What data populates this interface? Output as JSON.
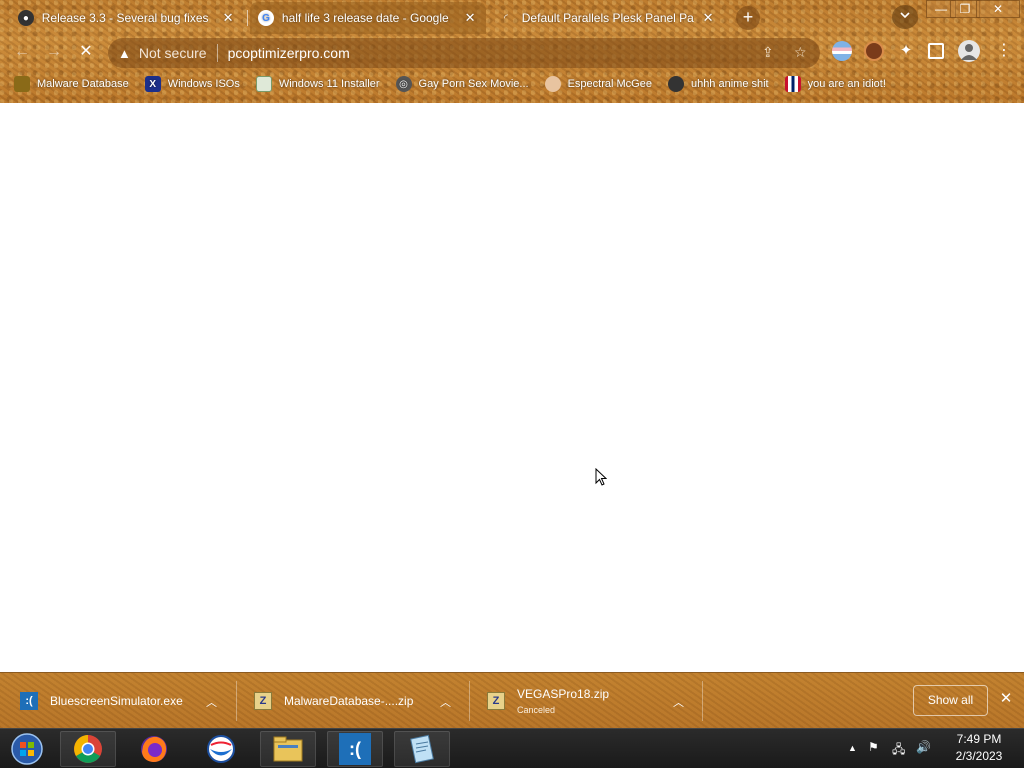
{
  "tabs": [
    {
      "title": "Release 3.3 - Several bug fixes",
      "favicon": "github-icon"
    },
    {
      "title": "half life 3 release date - Google",
      "favicon": "google-icon"
    },
    {
      "title": "Default Parallels Plesk Panel Page",
      "favicon": "loading-icon"
    }
  ],
  "window_controls": {
    "minimize": "—",
    "maximize": "❐",
    "close": "✕"
  },
  "omnibox": {
    "security_label": "Not secure",
    "url": "pcoptimizerpro.com"
  },
  "bookmarks": [
    {
      "label": "Malware Database",
      "icon": "malware-icon"
    },
    {
      "label": "Windows ISOs",
      "icon": "x-logo-icon"
    },
    {
      "label": "Windows 11 Installer",
      "icon": "image-icon"
    },
    {
      "label": "Gay Porn Sex Movie...",
      "icon": "disk-icon"
    },
    {
      "label": "Espectral McGee",
      "icon": "face-icon"
    },
    {
      "label": "uhhh anime shit",
      "icon": "anime-icon"
    },
    {
      "label": "you are an idiot!",
      "icon": "flag-icon"
    }
  ],
  "downloads": [
    {
      "name": "BluescreenSimulator.exe",
      "status": "",
      "icon": "bluescreen-icon"
    },
    {
      "name": "MalwareDatabase-....zip",
      "status": "",
      "icon": "zip-icon"
    },
    {
      "name": "VEGASPro18.zip",
      "status": "Canceled",
      "icon": "zip-icon"
    }
  ],
  "shelf": {
    "show_all": "Show all"
  },
  "taskbar": {
    "apps": [
      "start-orb",
      "chrome",
      "firefox",
      "opera",
      "file-explorer",
      "bluescreen-simulator",
      "notepad"
    ]
  },
  "clock": {
    "time": "7:49 PM",
    "date": "2/3/2023"
  },
  "colors": {
    "theme": "#b97a2f",
    "taskbar": "#1f1f1f"
  }
}
